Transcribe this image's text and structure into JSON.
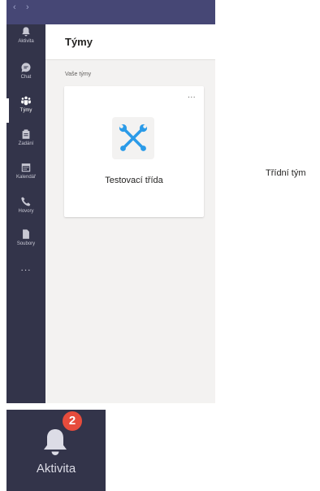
{
  "titlebar": {
    "back_glyph": "‹",
    "forward_glyph": "›"
  },
  "sidebar": {
    "items": [
      {
        "label": "Aktivita",
        "icon": "bell-icon",
        "active": false
      },
      {
        "label": "Chat",
        "icon": "chat-icon",
        "active": false
      },
      {
        "label": "Týmy",
        "icon": "teams-icon",
        "active": true
      },
      {
        "label": "Zadání",
        "icon": "assignments-icon",
        "active": false
      },
      {
        "label": "Kalendář",
        "icon": "calendar-icon",
        "active": false
      },
      {
        "label": "Hovory",
        "icon": "phone-icon",
        "active": false
      },
      {
        "label": "Soubory",
        "icon": "file-icon",
        "active": false
      }
    ],
    "more": "..."
  },
  "header": {
    "title": "Týmy"
  },
  "section": {
    "label": "Vaše týmy"
  },
  "team_card": {
    "name": "Testovací třída",
    "more": "...",
    "icon": "wrench-screwdriver-icon"
  },
  "annotation": {
    "class_type": "Třídní tým"
  },
  "zoom": {
    "label": "Aktivita",
    "badge": "2",
    "icon": "bell-icon"
  },
  "colors": {
    "rail": "#33344a",
    "topbar": "#464775",
    "content_bg": "#f3f2f1",
    "badge": "#e74c3c",
    "icon_blue": "#2b9be8"
  }
}
